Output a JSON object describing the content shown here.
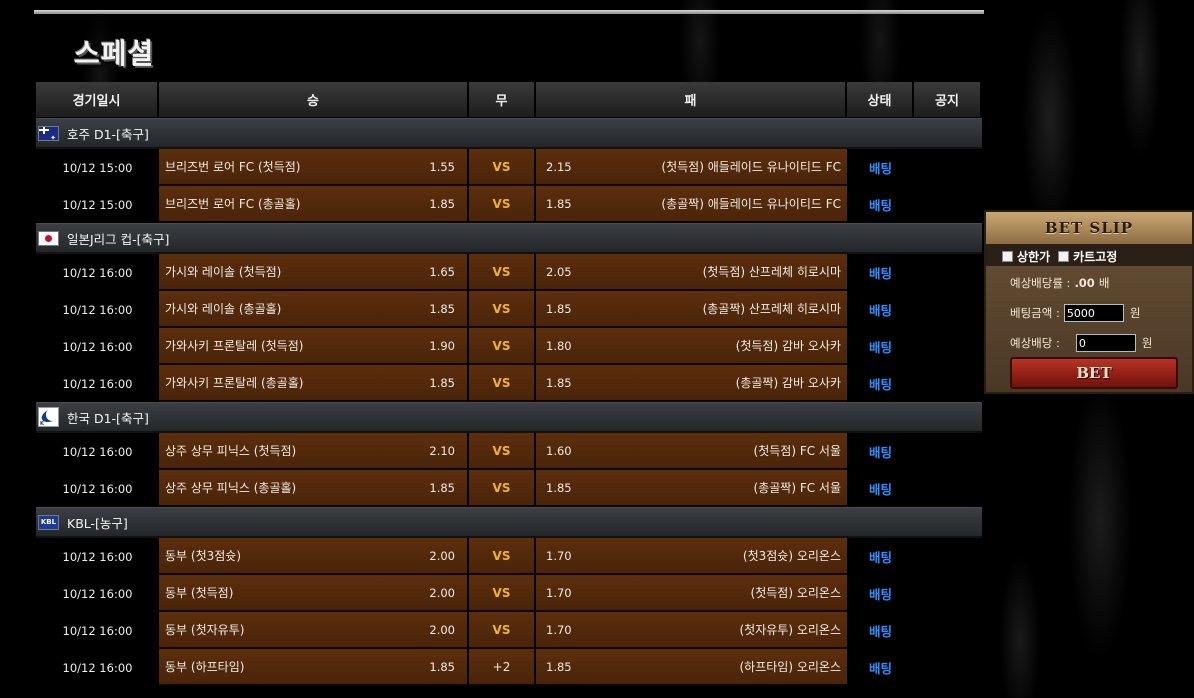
{
  "page": {
    "title": "스페셜"
  },
  "table": {
    "headers": {
      "date": "경기일시",
      "win": "승",
      "draw": "무",
      "lose": "패",
      "state": "상태",
      "note": "공지"
    },
    "leagues": [
      {
        "flag": "flag-au",
        "name": "호주 D1-[축구]",
        "matches": [
          {
            "date": "10/12 15:00",
            "home": "브리즈번 로어 FC (첫득점)",
            "home_odds": "1.55",
            "draw": "VS",
            "away_odds": "2.15",
            "away": "(첫득점) 애들레이드 유나이티드 FC",
            "state": "배팅"
          },
          {
            "date": "10/12 15:00",
            "home": "브리즈번 로어 FC (총골홀)",
            "home_odds": "1.85",
            "draw": "VS",
            "away_odds": "1.85",
            "away": "(총골짝) 애들레이드 유나이티드 FC",
            "state": "배팅"
          }
        ]
      },
      {
        "flag": "flag-jp",
        "name": "일본J리그 컵-[축구]",
        "matches": [
          {
            "date": "10/12 16:00",
            "home": "가시와 레이솔 (첫득점)",
            "home_odds": "1.65",
            "draw": "VS",
            "away_odds": "2.05",
            "away": "(첫득점) 산프레체 히로시마",
            "state": "배팅"
          },
          {
            "date": "10/12 16:00",
            "home": "가시와 레이솔 (총골홀)",
            "home_odds": "1.85",
            "draw": "VS",
            "away_odds": "1.85",
            "away": "(총골짝) 산프레체 히로시마",
            "state": "배팅"
          },
          {
            "date": "10/12 16:00",
            "home": "가와사키 프론탈레 (첫득점)",
            "home_odds": "1.90",
            "draw": "VS",
            "away_odds": "1.80",
            "away": "(첫득점) 감바 오사카",
            "state": "배팅"
          },
          {
            "date": "10/12 16:00",
            "home": "가와사키 프론탈레 (총골홀)",
            "home_odds": "1.85",
            "draw": "VS",
            "away_odds": "1.85",
            "away": "(총골짝) 감바 오사카",
            "state": "배팅"
          }
        ]
      },
      {
        "flag": "flag-kr",
        "name": "한국 D1-[축구]",
        "matches": [
          {
            "date": "10/12 16:00",
            "home": "상주 상무 피닉스 (첫득점)",
            "home_odds": "2.10",
            "draw": "VS",
            "away_odds": "1.60",
            "away": "(첫득점) FC 서울",
            "state": "배팅"
          },
          {
            "date": "10/12 16:00",
            "home": "상주 상무 피닉스 (총골홀)",
            "home_odds": "1.85",
            "draw": "VS",
            "away_odds": "1.85",
            "away": "(총골짝) FC 서울",
            "state": "배팅"
          }
        ]
      },
      {
        "flag": "flag-kbl",
        "flag_text": "KBL",
        "name": "KBL-[농구]",
        "matches": [
          {
            "date": "10/12 16:00",
            "home": "동부 (첫3점슛)",
            "home_odds": "2.00",
            "draw": "VS",
            "away_odds": "1.70",
            "away": "(첫3점슛) 오리온스",
            "state": "배팅"
          },
          {
            "date": "10/12 16:00",
            "home": "동부 (첫득점)",
            "home_odds": "2.00",
            "draw": "VS",
            "away_odds": "1.70",
            "away": "(첫득점) 오리온스",
            "state": "배팅"
          },
          {
            "date": "10/12 16:00",
            "home": "동부 (첫자유투)",
            "home_odds": "2.00",
            "draw": "VS",
            "away_odds": "1.70",
            "away": "(첫자유투) 오리온스",
            "state": "배팅"
          },
          {
            "date": "10/12 16:00",
            "home": "동부 (하프타임)",
            "home_odds": "1.85",
            "draw": "+2",
            "away_odds": "1.85",
            "away": "(하프타임) 오리온스",
            "state": "배팅"
          }
        ]
      }
    ]
  },
  "bet_slip": {
    "title": "BET SLIP",
    "option_upper": "상한가",
    "option_cart": "카트고정",
    "rate_label": "예상배당률 :",
    "rate_value": ".00",
    "rate_unit": "배",
    "amount_label": "베팅금액 :",
    "amount_value": "5000",
    "amount_unit": "원",
    "payout_label": "예상배당 :",
    "payout_value": "0",
    "payout_unit": "원",
    "bet_button": "BET"
  }
}
